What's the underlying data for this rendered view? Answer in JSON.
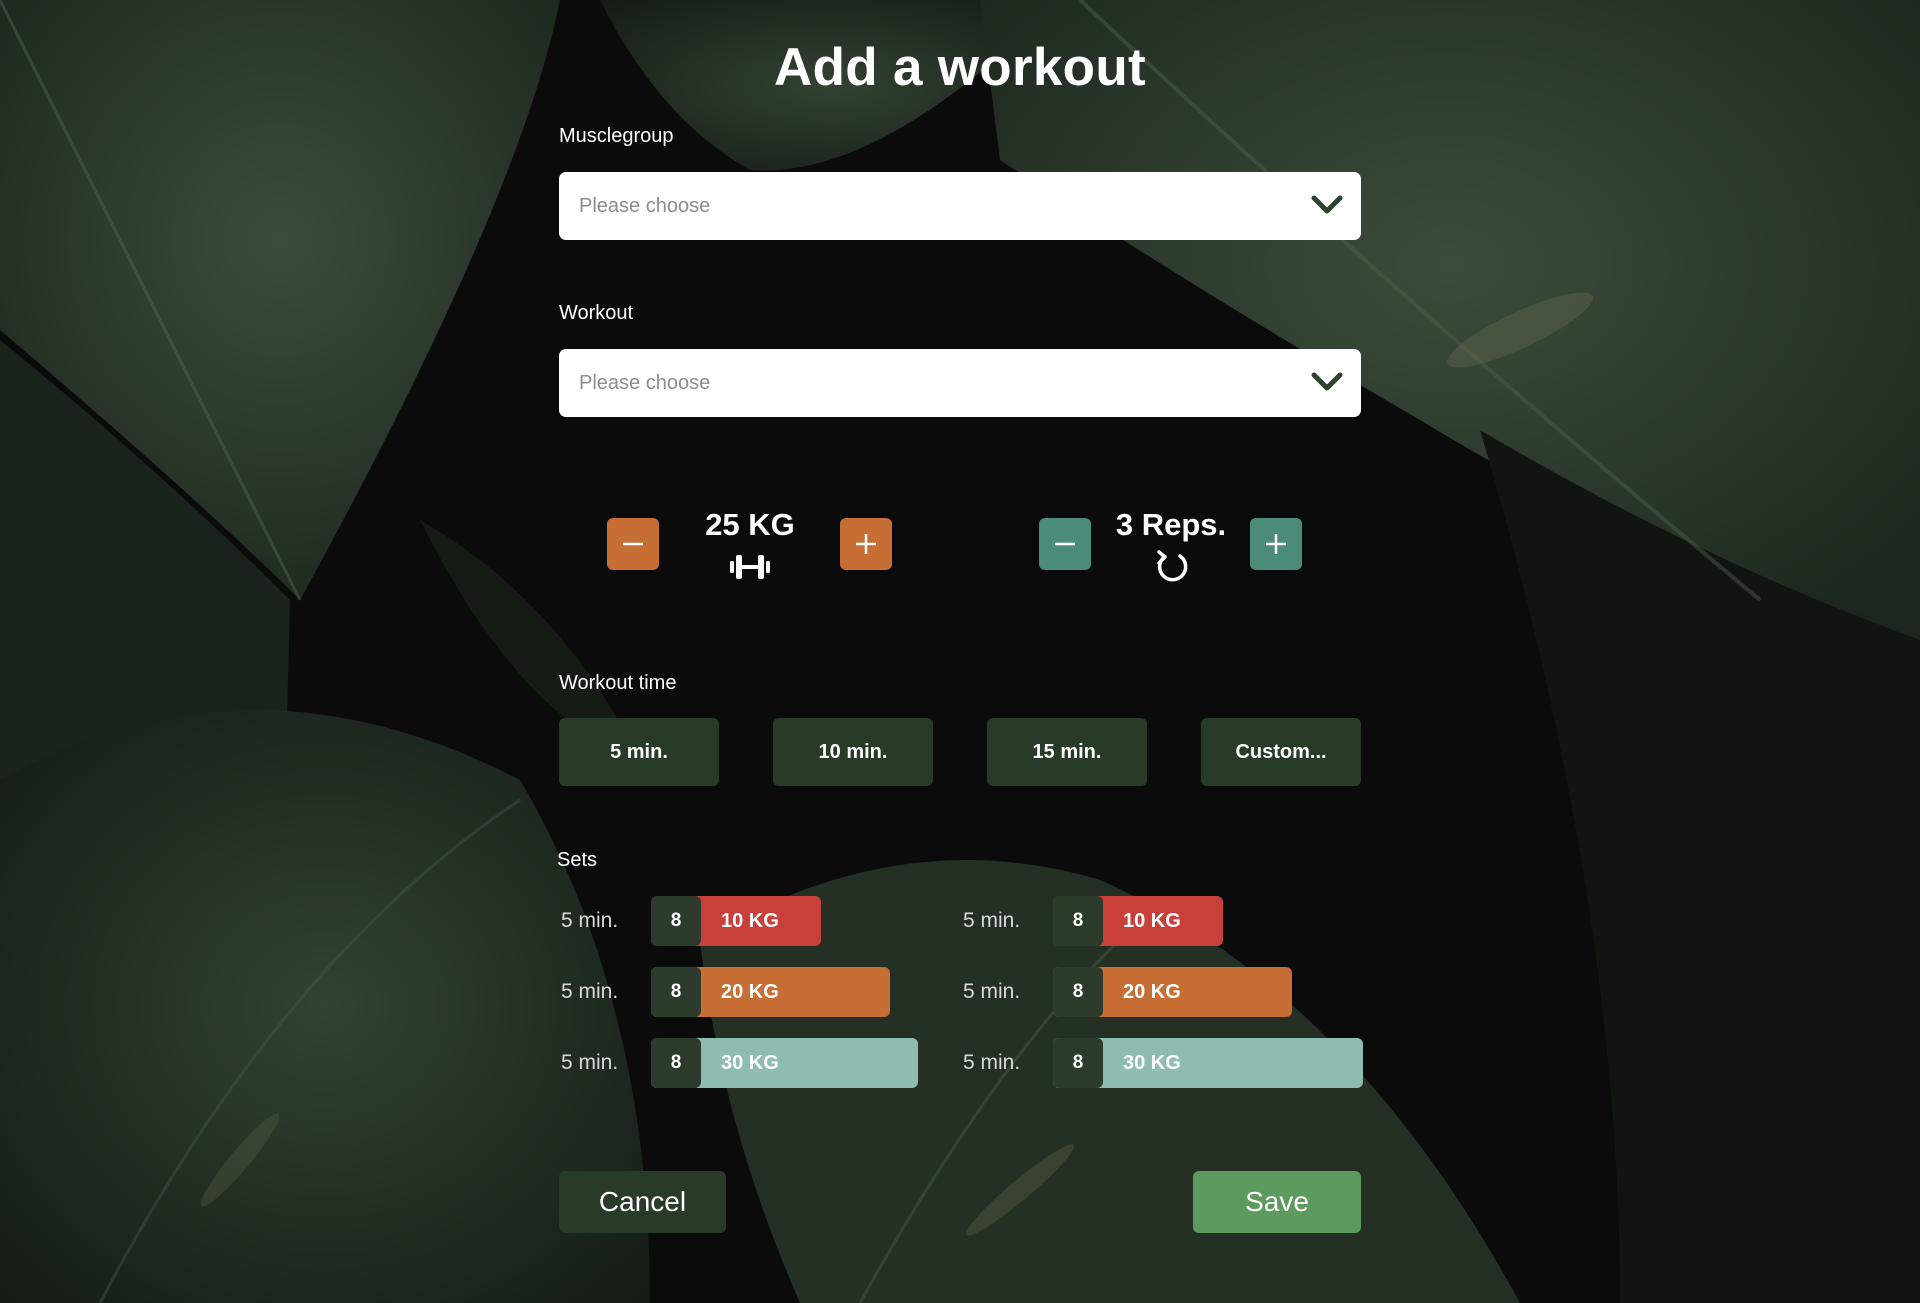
{
  "page": {
    "title": "Add a workout"
  },
  "musclegroup": {
    "label": "Musclegroup",
    "placeholder": "Please choose",
    "icon": "chevron-down-icon"
  },
  "workout": {
    "label": "Workout",
    "placeholder": "Please choose",
    "icon": "chevron-down-icon"
  },
  "weight": {
    "value": "25 KG",
    "icon": "dumbbell-icon",
    "decrease_icon": "minus-icon",
    "increase_icon": "plus-icon",
    "color": "#c66e34"
  },
  "reps": {
    "value": "3 Reps.",
    "icon": "repeat-icon",
    "decrease_icon": "minus-icon",
    "increase_icon": "plus-icon",
    "color": "#4b8c78"
  },
  "workout_time": {
    "label": "Workout time",
    "options": [
      "5 min.",
      "10 min.",
      "15 min.",
      "Custom..."
    ]
  },
  "sets": {
    "label": "Sets",
    "columns": [
      [
        {
          "time": "5 min.",
          "count": "8",
          "weight": "10 KG",
          "color": "#c9403a"
        },
        {
          "time": "5 min.",
          "count": "8",
          "weight": "20 KG",
          "color": "#c66e34"
        },
        {
          "time": "5 min.",
          "count": "8",
          "weight": "30 KG",
          "color": "#8fbcb0"
        }
      ],
      [
        {
          "time": "5 min.",
          "count": "8",
          "weight": "10 KG",
          "color": "#c9403a"
        },
        {
          "time": "5 min.",
          "count": "8",
          "weight": "20 KG",
          "color": "#c66e34"
        },
        {
          "time": "5 min.",
          "count": "8",
          "weight": "30 KG",
          "color": "#8fbcb0"
        }
      ]
    ]
  },
  "actions": {
    "cancel": "Cancel",
    "save": "Save",
    "save_color": "#5c9a5e",
    "cancel_color": "#283a28"
  }
}
